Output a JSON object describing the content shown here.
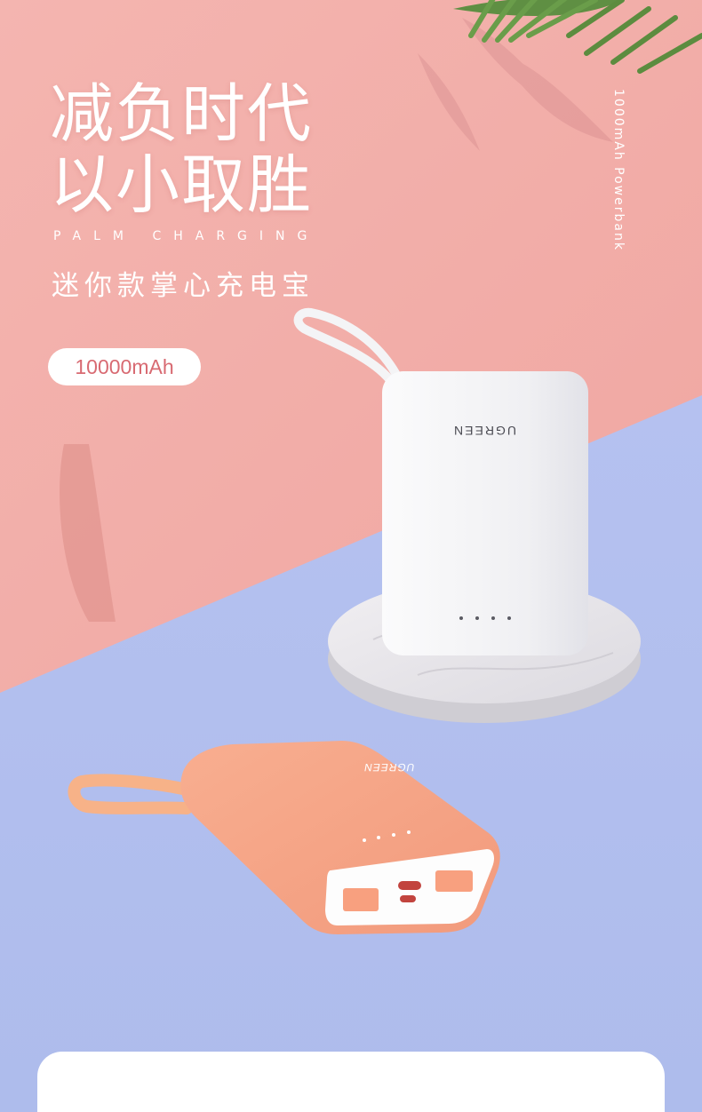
{
  "headline": {
    "line1": "减负时代",
    "line2": "以小取胜"
  },
  "english_tagline": "PALM CHARGING",
  "subtitle": "迷你款掌心充电宝",
  "capacity_pill": "10000mAh",
  "vertical_label": "1000mAh Powerbank",
  "product": {
    "brand_logo": "UGREEN"
  },
  "colors": {
    "wall_pink": "#f2aca7",
    "floor_blue": "#b7c3f0",
    "white_device": "#f2f2f4",
    "coral_device": "#f6a182",
    "pill_text": "#d86a72"
  }
}
